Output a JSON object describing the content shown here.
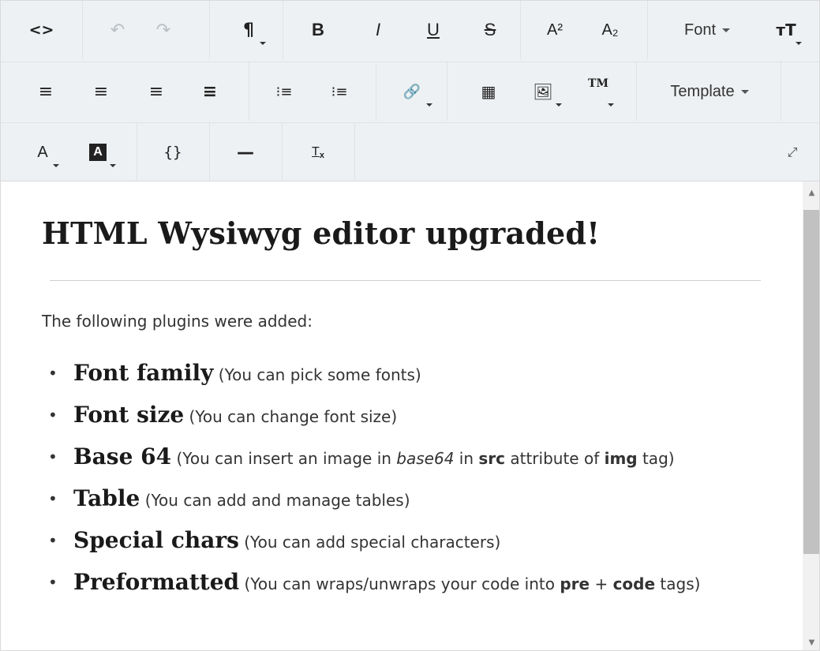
{
  "toolbar": {
    "code_view": "<>",
    "undo": "↶",
    "redo": "↷",
    "paragraph": "¶",
    "bold": "B",
    "italic": "I",
    "underline": "U",
    "strikethrough": "S",
    "superscript": "A²",
    "subscript": "A₂",
    "font_label": "Font",
    "font_size": "тT",
    "align_left": "≡",
    "align_center": "≡",
    "align_right": "≡",
    "justify": "≡",
    "bullet_list": "⁝≡",
    "ordered_list": "⁝≡",
    "link": "🔗",
    "table": "▦",
    "image": "🖼",
    "special_chars": "TM",
    "template_label": "Template",
    "text_color": "A",
    "bg_color": "A",
    "preformatted": "{}",
    "horizontal_rule": "—",
    "clear_format": "T",
    "fullscreen": "⤢"
  },
  "content": {
    "heading": "HTML Wysiwyg editor upgraded!",
    "intro": "The following plugins were added:",
    "items": [
      {
        "title": "Font family",
        "desc": "(You can pick some fonts)"
      },
      {
        "title": "Font size",
        "desc": "(You can change font size)"
      },
      {
        "title": "Base 64",
        "desc_prefix": "(You can insert an image in ",
        "em": "base64",
        "mid1": " in ",
        "b1": "src",
        "mid2": " attribute of ",
        "b2": "img",
        "desc_suffix": " tag)"
      },
      {
        "title": "Table",
        "desc": "(You can add and manage tables)"
      },
      {
        "title": "Special chars",
        "desc": "(You can add special characters)"
      },
      {
        "title": "Preformatted",
        "desc_prefix": "(You can wraps/unwraps your code into ",
        "b1": "pre",
        "mid1": " + ",
        "b2": "code",
        "desc_suffix": " tags)"
      }
    ]
  },
  "colors": {
    "toolbar_bg": "#eef1f3",
    "text": "#333333",
    "heading": "#1a1a1a",
    "scroll_thumb": "#c1c1c1"
  }
}
